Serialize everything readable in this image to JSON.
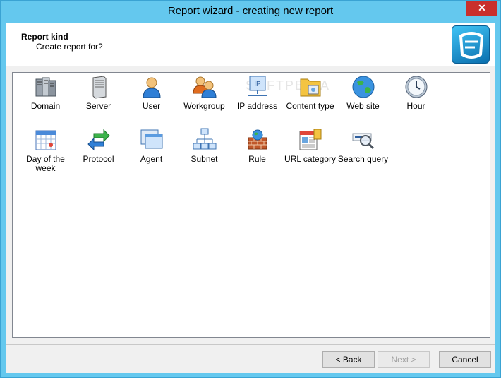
{
  "window": {
    "title": "Report wizard - creating new report",
    "close_glyph": "✕"
  },
  "header": {
    "title": "Report kind",
    "subtitle": "Create report for?"
  },
  "items": [
    {
      "label": "Domain",
      "icon": "domain-servers-icon"
    },
    {
      "label": "Server",
      "icon": "server-icon"
    },
    {
      "label": "User",
      "icon": "user-icon"
    },
    {
      "label": "Workgroup",
      "icon": "workgroup-icon"
    },
    {
      "label": "IP address",
      "icon": "ip-address-icon"
    },
    {
      "label": "Content type",
      "icon": "content-type-icon"
    },
    {
      "label": "Web site",
      "icon": "globe-icon"
    },
    {
      "label": "Hour",
      "icon": "clock-icon"
    },
    {
      "label": "Day of the week",
      "icon": "calendar-icon"
    },
    {
      "label": "Protocol",
      "icon": "protocol-arrows-icon"
    },
    {
      "label": "Agent",
      "icon": "agent-windows-icon"
    },
    {
      "label": "Subnet",
      "icon": "subnet-icon"
    },
    {
      "label": "Rule",
      "icon": "firewall-rule-icon"
    },
    {
      "label": "URL category",
      "icon": "url-category-icon"
    },
    {
      "label": "Search query",
      "icon": "search-query-icon"
    }
  ],
  "buttons": {
    "back": "< Back",
    "next": "Next >",
    "cancel": "Cancel"
  },
  "watermark": "SOFTPEDIA"
}
